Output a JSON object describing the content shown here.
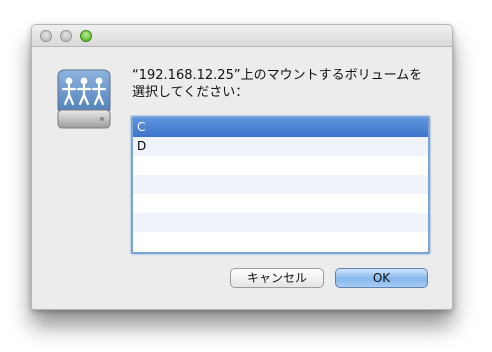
{
  "dialog": {
    "prompt": "“192.168.12.25”上のマウントするボリュームを\n選択してください："
  },
  "volumes": [
    {
      "label": "C",
      "selected": true
    },
    {
      "label": "D",
      "selected": false
    }
  ],
  "buttons": {
    "cancel_label": "キャンセル",
    "ok_label": "OK"
  },
  "colors": {
    "selection": "#3d74cc",
    "accent_button": "#85b6ec",
    "zoom_light": "#44a51c"
  },
  "icons": {
    "server": "network-server-icon"
  }
}
